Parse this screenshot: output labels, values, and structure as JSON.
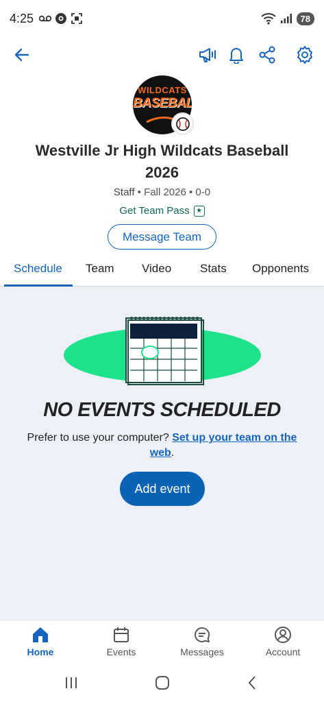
{
  "status_bar": {
    "time": "4:25",
    "battery": "78",
    "signal_label": "5"
  },
  "team": {
    "logo_line1": "WILDCATS",
    "logo_line2": "BASEBALL",
    "title_line1": "Westville Jr High Wildcats Baseball",
    "title_line2": "2026",
    "role": "Staff",
    "meta": " • Fall 2026 • 0-0",
    "pass_label": "Get Team Pass",
    "message_button": "Message Team"
  },
  "tabs": [
    {
      "label": "Schedule",
      "active": true
    },
    {
      "label": "Team",
      "active": false
    },
    {
      "label": "Video",
      "active": false
    },
    {
      "label": "Stats",
      "active": false
    },
    {
      "label": "Opponents",
      "active": false
    }
  ],
  "empty_state": {
    "title": "NO EVENTS SCHEDULED",
    "desc_prefix": "Prefer to use your computer? ",
    "desc_link": "Set up your team on the web",
    "desc_suffix": ".",
    "add_button": "Add event"
  },
  "bottom_nav": [
    {
      "label": "Home",
      "icon": "home-icon",
      "active": true
    },
    {
      "label": "Events",
      "icon": "calendar-icon",
      "active": false
    },
    {
      "label": "Messages",
      "icon": "chat-icon",
      "active": false
    },
    {
      "label": "Account",
      "icon": "account-icon",
      "active": false
    }
  ],
  "colors": {
    "accent": "#1565c0",
    "pass_green": "#0f6b4f",
    "content_bg": "#edf1f7",
    "ellipse": "#1de28a"
  }
}
